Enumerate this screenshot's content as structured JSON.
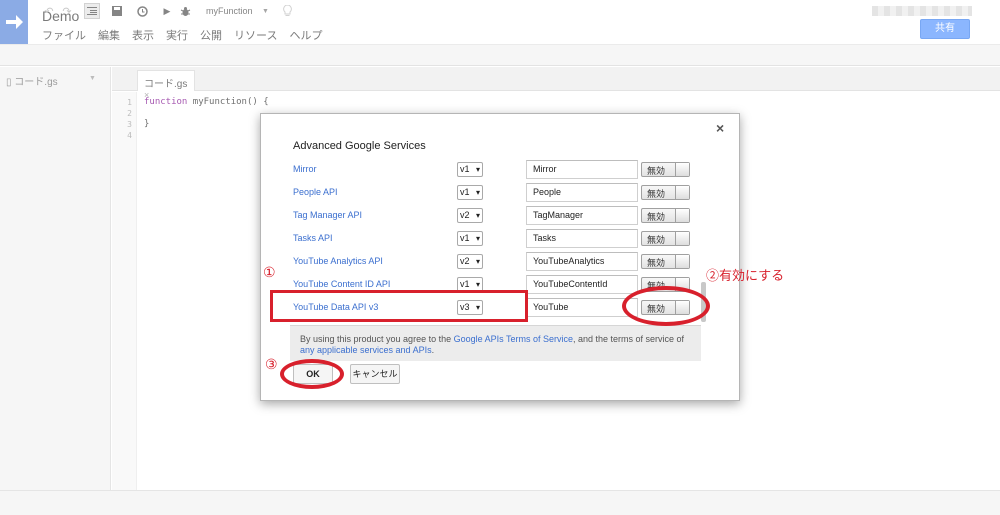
{
  "header": {
    "title": "Demo",
    "menu": [
      "ファイル",
      "編集",
      "表示",
      "実行",
      "公開",
      "リソース",
      "ヘルプ"
    ],
    "share_label": "共有",
    "accent": "#4d7fd8"
  },
  "toolbar": {
    "function_name": "myFunction"
  },
  "sidebar": {
    "file_label": "コード.gs"
  },
  "editor": {
    "tab_label": "コード.gs",
    "tab_close": "×",
    "line_numbers": [
      "1",
      "2",
      "3",
      "4"
    ],
    "lines": [
      {
        "kw": "function",
        "rest": " myFunction() {"
      },
      {
        "kw": "",
        "rest": ""
      },
      {
        "kw": "",
        "rest": "}"
      },
      {
        "kw": "",
        "rest": ""
      }
    ]
  },
  "dialog": {
    "title": "Advanced Google Services",
    "close_label": "×",
    "services": [
      {
        "name": "Mirror",
        "version": "v1",
        "identifier": "Mirror",
        "toggle": "無効"
      },
      {
        "name": "People API",
        "version": "v1",
        "identifier": "People",
        "toggle": "無効"
      },
      {
        "name": "Tag Manager API",
        "version": "v2",
        "identifier": "TagManager",
        "toggle": "無効"
      },
      {
        "name": "Tasks API",
        "version": "v1",
        "identifier": "Tasks",
        "toggle": "無効"
      },
      {
        "name": "YouTube Analytics API",
        "version": "v2",
        "identifier": "YouTubeAnalytics",
        "toggle": "無効"
      },
      {
        "name": "YouTube Content ID API",
        "version": "v1",
        "identifier": "YouTubeContentId",
        "toggle": "無効"
      },
      {
        "name": "YouTube Data API v3",
        "version": "v3",
        "identifier": "YouTube",
        "toggle": "無効"
      }
    ],
    "tos": {
      "prefix": "By using this product you agree to the ",
      "link1": "Google APIs Terms of Service",
      "middle": ", and the terms of service of ",
      "link2": "any applicable services and APIs",
      "suffix": "."
    },
    "ok_label": "OK",
    "cancel_label": "キャンセル"
  },
  "annotations": {
    "step1": "①",
    "step2": "②有効にする",
    "step3": "③",
    "color": "#d8202c"
  }
}
